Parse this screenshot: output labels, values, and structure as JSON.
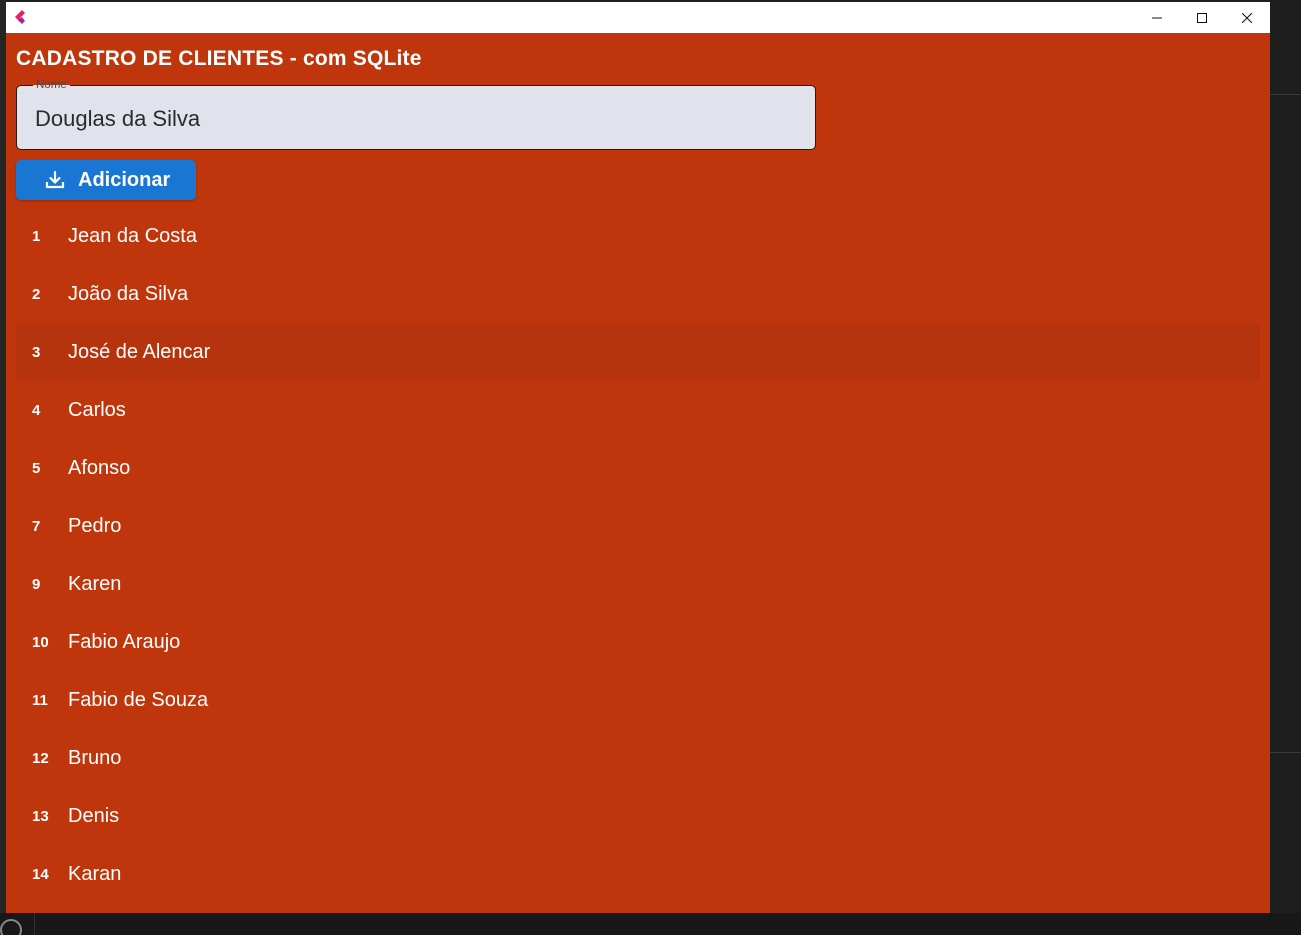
{
  "window": {
    "title": "",
    "icon": "flutter-logo-icon",
    "controls": {
      "minimize": "—",
      "maximize": "☐",
      "close": "✕"
    }
  },
  "page": {
    "title": "CADASTRO DE CLIENTES - com SQLite"
  },
  "name_field": {
    "label": "Nome",
    "value": "Douglas da Silva"
  },
  "add_button": {
    "label": "Adicionar",
    "icon": "download-icon"
  },
  "clients": [
    {
      "id": "1",
      "name": "Jean da Costa"
    },
    {
      "id": "2",
      "name": "João da Silva"
    },
    {
      "id": "3",
      "name": "José de Alencar"
    },
    {
      "id": "4",
      "name": "Carlos"
    },
    {
      "id": "5",
      "name": "Afonso"
    },
    {
      "id": "7",
      "name": "Pedro"
    },
    {
      "id": "9",
      "name": "Karen"
    },
    {
      "id": "10",
      "name": "Fabio Araujo"
    },
    {
      "id": "11",
      "name": "Fabio de Souza"
    },
    {
      "id": "12",
      "name": "Bruno"
    },
    {
      "id": "13",
      "name": "Denis"
    },
    {
      "id": "14",
      "name": "Karan"
    }
  ],
  "colors": {
    "background": "#bf360c",
    "button": "#1976d2",
    "field": "#e0e3ec",
    "hover_row": "#b6340d"
  }
}
